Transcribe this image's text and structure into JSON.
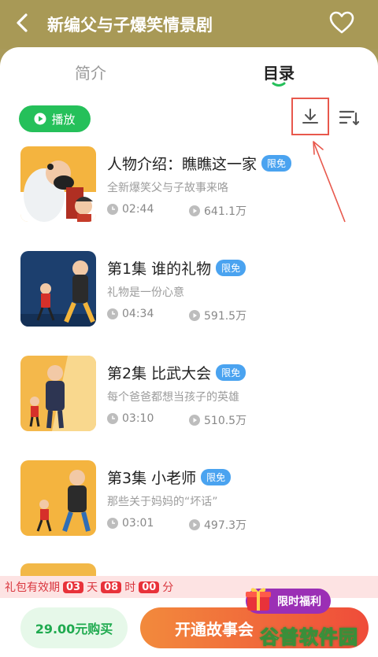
{
  "header": {
    "title": "新编父与子爆笑情景剧"
  },
  "tabs": {
    "intro": "简介",
    "catalog": "目录"
  },
  "toolbar": {
    "play_label": "播放"
  },
  "episodes": [
    {
      "title": "人物介绍：瞧瞧这一家",
      "badge": "限免",
      "desc": "全新爆笑父与子故事来咯",
      "duration": "02:44",
      "plays": "641.1万"
    },
    {
      "title": "第1集 谁的礼物",
      "badge": "限免",
      "desc": "礼物是一份心意",
      "duration": "04:34",
      "plays": "591.5万"
    },
    {
      "title": "第2集 比武大会",
      "badge": "限免",
      "desc": "每个爸爸都想当孩子的英雄",
      "duration": "03:10",
      "plays": "510.5万"
    },
    {
      "title": "第3集 小老师",
      "badge": "限免",
      "desc": "那些关于妈妈的“坏话”",
      "duration": "03:01",
      "plays": "497.3万"
    }
  ],
  "promo": {
    "prefix": "礼包有效期",
    "days": "03",
    "day_unit": "天",
    "hours": "08",
    "hour_unit": "时",
    "minutes": "00",
    "minute_unit": "分"
  },
  "bottom": {
    "buy_label": "29.00元购买",
    "vip_label": "开通故事会",
    "limited_label": "限时福利"
  },
  "watermark": "谷普软件园",
  "colors": {
    "header": "#a89956",
    "accent_green": "#25c05a",
    "badge_blue": "#4aa3f0",
    "annotation_red": "#e8584c"
  },
  "icons": [
    "back-arrow-icon",
    "heart-icon",
    "play-icon",
    "download-icon",
    "sort-icon",
    "clock-icon",
    "play-count-icon",
    "gift-icon"
  ]
}
